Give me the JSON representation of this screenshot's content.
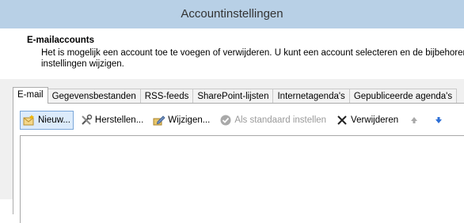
{
  "window": {
    "title": "Accountinstellingen"
  },
  "section": {
    "title": "E-mailaccounts",
    "desc_line1": "Het is mogelijk een account toe te voegen of verwijderen. U kunt een account selecteren en de bijbehorende",
    "desc_line2": "instellingen wijzigen."
  },
  "tabs": [
    {
      "label": "E-mail"
    },
    {
      "label": "Gegevensbestanden"
    },
    {
      "label": "RSS-feeds"
    },
    {
      "label": "SharePoint-lijsten"
    },
    {
      "label": "Internetagenda's"
    },
    {
      "label": "Gepubliceerde agenda's"
    }
  ],
  "toolbar": {
    "new_label": "Nieuw...",
    "repair_label": "Herstellen...",
    "change_label": "Wijzigen...",
    "default_label": "Als standaard instellen",
    "remove_label": "Verwijderen"
  },
  "icons": {
    "new": "new-mail-account-icon",
    "repair": "tools-icon",
    "change": "edit-icon",
    "default": "check-circle-icon",
    "remove": "close-x-icon",
    "up": "arrow-up-icon",
    "down": "arrow-down-icon"
  }
}
